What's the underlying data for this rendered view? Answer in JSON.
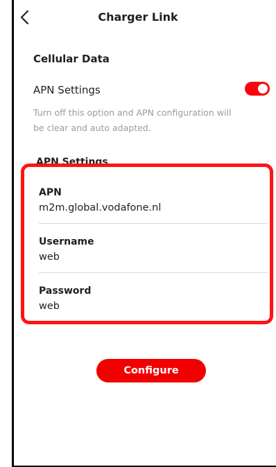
{
  "header": {
    "title": "Charger Link",
    "back_icon": "chevron-left-icon"
  },
  "cellular": {
    "section_title": "Cellular Data",
    "apn_settings_label": "APN Settings",
    "apn_toggle": {
      "state": "on",
      "color": "#ff000f"
    },
    "hint": "Turn off this option and APN configuration will be clear and auto adapted."
  },
  "apn_form": {
    "subheader": "APN Settings",
    "fields": [
      {
        "label": "APN",
        "value": "m2m.global.vodafone.nl"
      },
      {
        "label": "Username",
        "value": "web"
      },
      {
        "label": "Password",
        "value": "web"
      }
    ]
  },
  "actions": {
    "configure_label": "Configure"
  },
  "colors": {
    "accent": "#f20000",
    "highlight_border": "#ff1313",
    "hint_text": "#9a9a9a"
  }
}
